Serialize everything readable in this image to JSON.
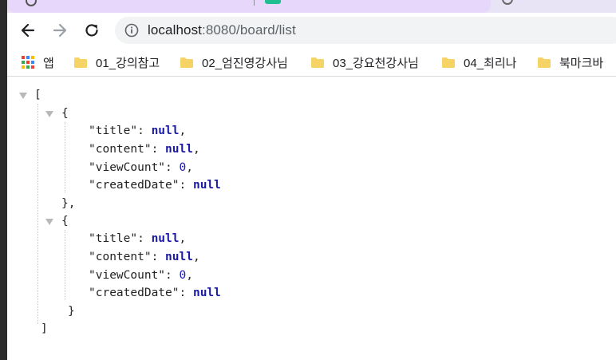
{
  "browser": {
    "address_url": "localhost:8080/board/list",
    "address_host": "localhost",
    "address_rest": ":8080/board/list"
  },
  "bookmarks": [
    {
      "label": "앱",
      "icon": "apps-grid-icon"
    },
    {
      "label": "01_강의참고",
      "icon": "folder-icon"
    },
    {
      "label": "02_엄진영강사님",
      "icon": "folder-icon"
    },
    {
      "label": "03_강요천강사님",
      "icon": "folder-icon"
    },
    {
      "label": "04_최리나",
      "icon": "folder-icon"
    },
    {
      "label": "북마크바",
      "icon": "folder-icon"
    }
  ],
  "json_viewer": {
    "open_bracket": "[",
    "close_bracket": "]",
    "items": [
      {
        "open": "{",
        "close": "},",
        "fields": [
          {
            "key": "\"title\"",
            "value": "null",
            "sep": ","
          },
          {
            "key": "\"content\"",
            "value": "null",
            "sep": ","
          },
          {
            "key": "\"viewCount\"",
            "value": "0",
            "sep": ","
          },
          {
            "key": "\"createdDate\"",
            "value": "null",
            "sep": ""
          }
        ]
      },
      {
        "open": "{",
        "close": "}",
        "fields": [
          {
            "key": "\"title\"",
            "value": "null",
            "sep": ","
          },
          {
            "key": "\"content\"",
            "value": "null",
            "sep": ","
          },
          {
            "key": "\"viewCount\"",
            "value": "0",
            "sep": ","
          },
          {
            "key": "\"createdDate\"",
            "value": "null",
            "sep": ""
          }
        ]
      }
    ]
  },
  "colors": {
    "tab_active": "#e6d7fb",
    "address_bg": "#f1f3f4",
    "folder": "#f6d365",
    "json_literal": "#1a1aa6"
  }
}
